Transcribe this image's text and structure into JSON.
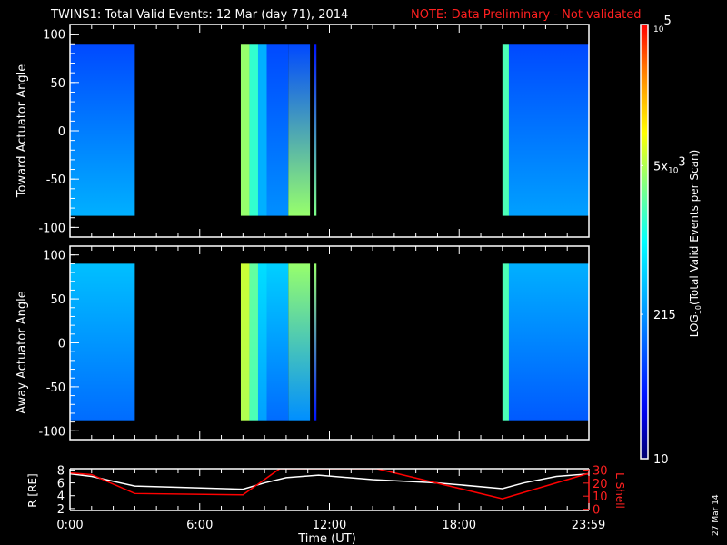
{
  "chart_data": [
    {
      "type": "heatmap",
      "title": "TWINS1: Total Valid Events: 12 Mar (day  71), 2014",
      "note": "NOTE: Data Preliminary - Not validated",
      "panel": "toward",
      "ylabel": "Toward Actuator Angle",
      "ylim": [
        -110,
        110
      ],
      "yticks": [
        "100",
        "50",
        "0",
        "-50",
        "-100"
      ],
      "ytick_values": [
        100,
        50,
        0,
        -50,
        -100
      ],
      "xlim": [
        0,
        24
      ],
      "data_angle_range": [
        -88,
        90
      ],
      "segments": [
        {
          "start": 0,
          "end": 3.0,
          "top": 1.9,
          "bottom": 2.5
        },
        {
          "start": 7.9,
          "end": 8.3,
          "top": 3.6,
          "bottom": 3.6
        },
        {
          "start": 8.3,
          "end": 8.7,
          "top": 3.2,
          "bottom": 3.2
        },
        {
          "start": 8.7,
          "end": 9.1,
          "top": 2.5,
          "bottom": 2.5
        },
        {
          "start": 9.1,
          "end": 10.1,
          "top": 1.9,
          "bottom": 2.3
        },
        {
          "start": 10.1,
          "end": 11.1,
          "top": 1.9,
          "bottom": 3.6
        },
        {
          "start": 11.3,
          "end": 11.4,
          "top": 1.6,
          "bottom": 3.5
        },
        {
          "start": 20.0,
          "end": 20.3,
          "top": 3.3,
          "bottom": 3.3
        },
        {
          "start": 20.3,
          "end": 24,
          "top": 1.9,
          "bottom": 2.4
        }
      ]
    },
    {
      "type": "heatmap",
      "panel": "away",
      "ylabel": "Away Actuator Angle",
      "ylim": [
        -110,
        110
      ],
      "yticks": [
        "100",
        "50",
        "0",
        "-50",
        "-100"
      ],
      "ytick_values": [
        100,
        50,
        0,
        -50,
        -100
      ],
      "xlim": [
        0,
        24
      ],
      "data_angle_range": [
        -88,
        90
      ],
      "segments": [
        {
          "start": 0,
          "end": 3.0,
          "top": 2.6,
          "bottom": 2.1
        },
        {
          "start": 7.9,
          "end": 8.3,
          "top": 3.8,
          "bottom": 3.7
        },
        {
          "start": 8.3,
          "end": 8.7,
          "top": 3.4,
          "bottom": 3.3
        },
        {
          "start": 8.7,
          "end": 9.1,
          "top": 2.8,
          "bottom": 2.4
        },
        {
          "start": 9.1,
          "end": 10.1,
          "top": 2.7,
          "bottom": 2.1
        },
        {
          "start": 10.1,
          "end": 11.1,
          "top": 3.6,
          "bottom": 2.3
        },
        {
          "start": 11.3,
          "end": 11.4,
          "top": 3.6,
          "bottom": 1.6
        },
        {
          "start": 20.0,
          "end": 20.3,
          "top": 3.3,
          "bottom": 3.3
        },
        {
          "start": 20.3,
          "end": 24,
          "top": 2.5,
          "bottom": 2.0
        }
      ]
    },
    {
      "type": "line",
      "xlabel": "Time (UT)",
      "xticks": [
        "0:00",
        "6:00",
        "12:00",
        "18:00",
        "23:59"
      ],
      "xtick_values": [
        0,
        6,
        12,
        18,
        23.98
      ],
      "ylabel": "R [RE]",
      "ylim": [
        1.7,
        8.2
      ],
      "yticks": [
        "2",
        "4",
        "6",
        "8"
      ],
      "ytick_values": [
        2,
        4,
        6,
        8
      ],
      "y2label": "L Shell",
      "y2lim": [
        -1,
        31
      ],
      "y2ticks": [
        "0",
        "10",
        "20",
        "30"
      ],
      "y2tick_values": [
        0,
        10,
        20,
        30
      ],
      "series": [
        {
          "name": "R",
          "color": "#ffffff",
          "x": [
            0,
            1,
            3,
            5,
            8,
            9,
            10,
            11.5,
            14,
            17,
            20,
            21,
            22.5,
            24
          ],
          "y": [
            7.4,
            7.0,
            5.5,
            5.3,
            5.0,
            6.0,
            6.8,
            7.2,
            6.5,
            6.0,
            5.1,
            6.0,
            7.0,
            7.4
          ]
        },
        {
          "name": "L Shell",
          "color": "#ff0000",
          "x": [
            0,
            1,
            3,
            8,
            9.7,
            14.2,
            20,
            24
          ],
          "y": [
            27.8,
            26.5,
            12,
            11,
            31,
            31,
            8,
            27.5
          ]
        }
      ]
    },
    {
      "type": "colorbar",
      "label": "LOG10(Total Valid Events per Scan)",
      "label_main": "LOG",
      "label_sub": "10",
      "label_rest": "(Total Valid Events per Scan)",
      "log_range": [
        1,
        5
      ],
      "ticks": [
        {
          "base": "10",
          "exp": "5",
          "value": 5
        },
        {
          "prefix": "5x",
          "base": "10",
          "exp": "3",
          "value": 3.7
        },
        {
          "text": "215",
          "value": 2.33
        },
        {
          "text": "10",
          "value": 1
        }
      ]
    }
  ],
  "footer": {
    "date_stamp": "27 Mar 14"
  }
}
